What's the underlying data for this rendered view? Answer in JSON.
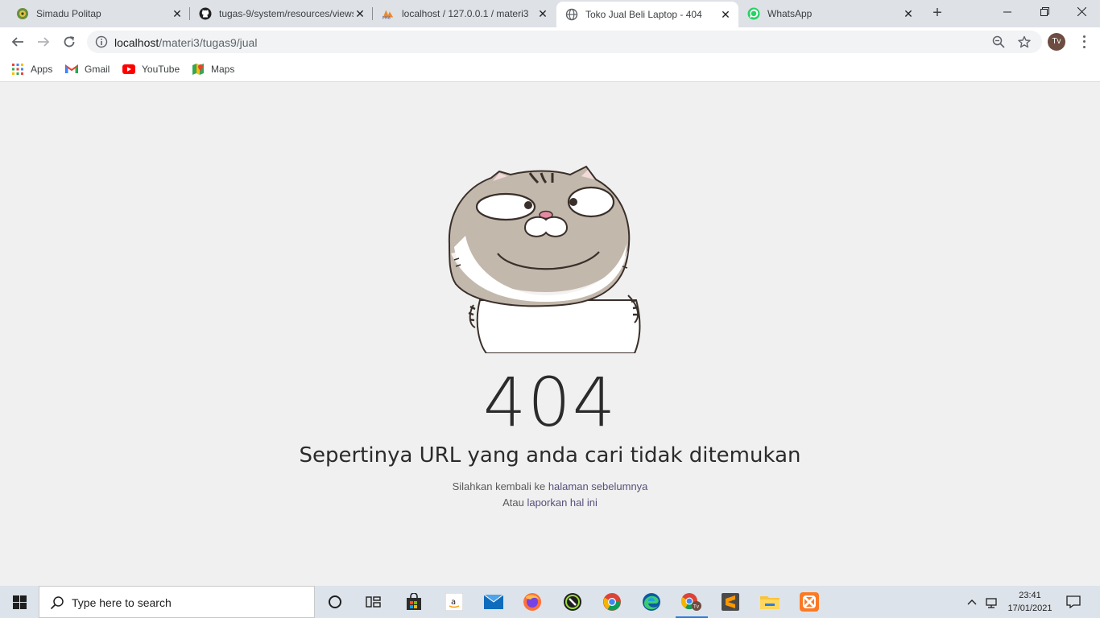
{
  "browser": {
    "tabs": [
      {
        "title": "Simadu Politap",
        "icon": "politap-logo-icon",
        "active": false
      },
      {
        "title": "tugas-9/system/resources/views",
        "icon": "github-icon",
        "active": false
      },
      {
        "title": "localhost / 127.0.0.1 / materi3",
        "icon": "phpmyadmin-icon",
        "active": false
      },
      {
        "title": "Toko Jual Beli Laptop - 404",
        "icon": "globe-icon",
        "active": true
      },
      {
        "title": "WhatsApp",
        "icon": "whatsapp-icon",
        "active": false
      }
    ],
    "tab_close_glyph": "✕",
    "new_tab_glyph": "+",
    "url_host": "localhost",
    "url_path": "/materi3/tugas9/jual",
    "profile_initials": "Tv",
    "bookmarks": [
      {
        "label": "Apps",
        "icon": "apps-grid-icon"
      },
      {
        "label": "Gmail",
        "icon": "gmail-icon"
      },
      {
        "label": "YouTube",
        "icon": "youtube-icon"
      },
      {
        "label": "Maps",
        "icon": "maps-icon"
      }
    ]
  },
  "page": {
    "illustration": "cat-meme-illustration",
    "code": "404",
    "message": "Sepertinya URL yang anda cari tidak ditemukan",
    "line1_prefix": "Silahkan kembali ke ",
    "line1_link": "halaman sebelumnya",
    "line2_prefix": "Atau ",
    "line2_link": "laporkan hal ini"
  },
  "taskbar": {
    "search_placeholder": "Type here to search",
    "time": "23:41",
    "date": "17/01/2021",
    "apps": [
      "cortana-icon",
      "task-view-icon",
      "store-icon",
      "amazon-icon",
      "mail-icon",
      "firefox-icon",
      "app-icon",
      "chrome-icon",
      "edge-icon",
      "chrome-profile-icon",
      "sublime-icon",
      "file-explorer-icon",
      "xampp-icon"
    ]
  },
  "colors": {
    "page_bg": "#f0f0f0",
    "text": "#2b2b2b",
    "link": "#55507a",
    "tabstrip": "#dee1e6",
    "taskbar": "#dde3ea"
  }
}
